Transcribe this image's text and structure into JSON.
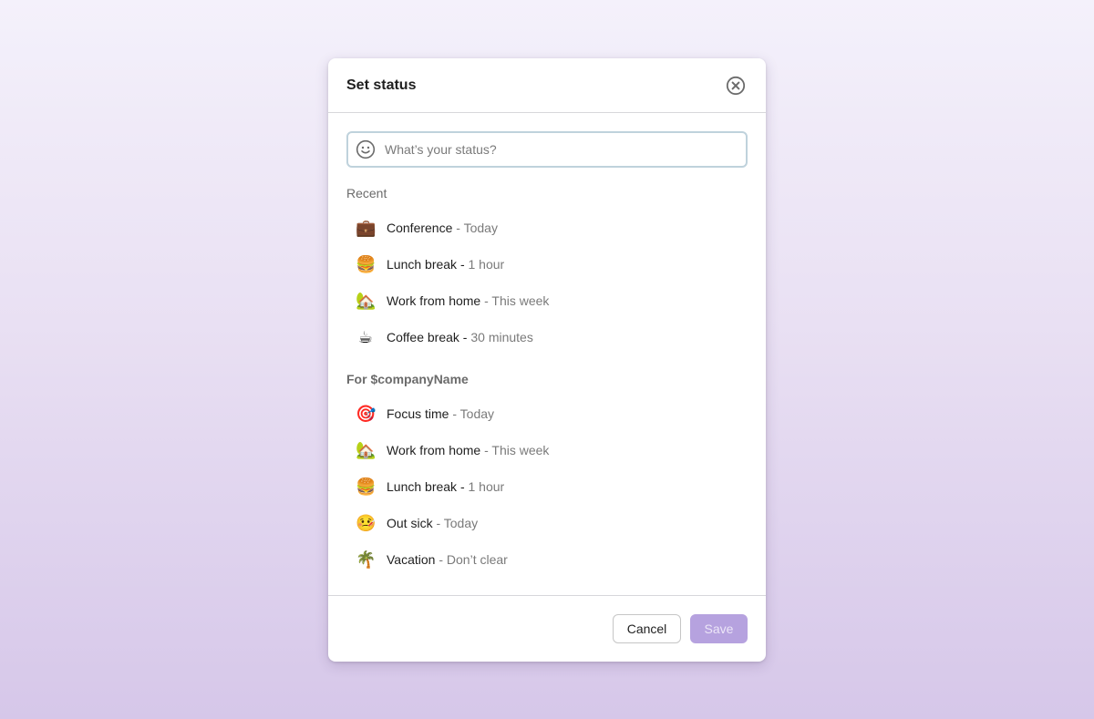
{
  "dialog": {
    "title": "Set status",
    "close_icon": "close-circle-icon"
  },
  "search": {
    "icon": "smiley-icon",
    "placeholder": "What’s your status?",
    "value": ""
  },
  "recent": {
    "label": "Recent",
    "items": [
      {
        "emoji": "💼",
        "icon": "briefcase-icon",
        "name": "Conference",
        "duration": " - Today"
      },
      {
        "emoji": "🍔",
        "icon": "hamburger-icon",
        "name": "Lunch break - ",
        "duration": "1 hour"
      },
      {
        "emoji": "🏡",
        "icon": "house-icon",
        "name": "Work from home",
        "duration": " - This week"
      },
      {
        "emoji": "☕",
        "icon": "coffee-icon",
        "name": "Coffee break - ",
        "duration": "30 minutes"
      }
    ]
  },
  "company": {
    "label": "For $companyName",
    "items": [
      {
        "emoji": "🎯",
        "icon": "target-icon",
        "name": "Focus time",
        "duration": " - Today"
      },
      {
        "emoji": "🏡",
        "icon": "house-icon",
        "name": "Work from home",
        "duration": " - This week"
      },
      {
        "emoji": "🍔",
        "icon": "hamburger-icon",
        "name": "Lunch break - ",
        "duration": "1 hour"
      },
      {
        "emoji": "🤒",
        "icon": "sick-face-icon",
        "name": "Out sick",
        "duration": " - Today"
      },
      {
        "emoji": "🌴",
        "icon": "palm-tree-icon",
        "name": "Vacation",
        "duration": " - Don’t clear"
      }
    ]
  },
  "footer": {
    "cancel_label": "Cancel",
    "save_label": "Save"
  },
  "colors": {
    "save_disabled_bg": "#b6a2df",
    "input_border": "#bfd2dc"
  }
}
